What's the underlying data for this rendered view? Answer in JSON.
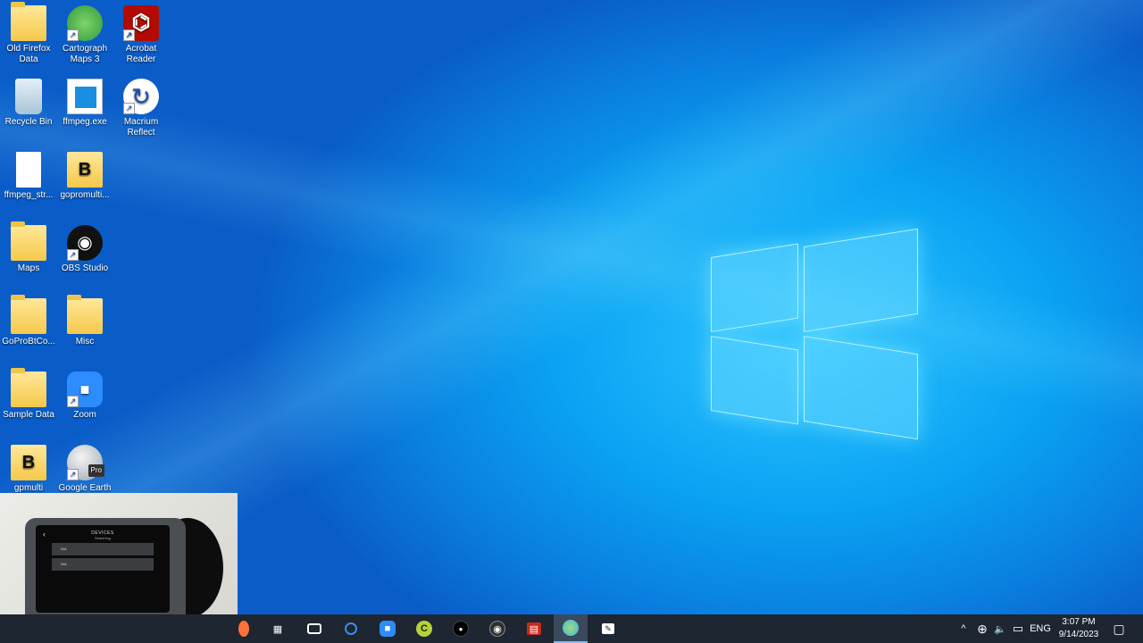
{
  "desktop": {
    "icons": [
      {
        "label": "Old Firefox Data",
        "icon": "folder-icon"
      },
      {
        "label": "Cartograph Maps 3",
        "icon": "cartograph-icon"
      },
      {
        "label": "Acrobat Reader",
        "icon": "acrobat-icon"
      },
      {
        "label": "Recycle Bin",
        "icon": "recycle-bin-icon"
      },
      {
        "label": "ffmpeg.exe",
        "icon": "ffmpeg-icon"
      },
      {
        "label": "Macrium Reflect",
        "icon": "macrium-icon"
      },
      {
        "label": "ffmpeg_str...",
        "icon": "document-icon"
      },
      {
        "label": "gopromulti...",
        "icon": "batch-file-icon"
      },
      {
        "label": "Maps",
        "icon": "folder-icon"
      },
      {
        "label": "OBS Studio",
        "icon": "obs-icon"
      },
      {
        "label": "GoProBtCo...",
        "icon": "folder-icon"
      },
      {
        "label": "Misc",
        "icon": "folder-icon"
      },
      {
        "label": "Sample Data",
        "icon": "folder-icon"
      },
      {
        "label": "Zoom",
        "icon": "zoom-icon"
      },
      {
        "label": "gpmulti",
        "icon": "batch-file-icon"
      },
      {
        "label": "Google Earth",
        "icon": "google-earth-icon"
      }
    ],
    "google_earth_badge": "Pro"
  },
  "webcam": {
    "screen_title": "DEVICES",
    "screen_subtitle": "Searching",
    "rows": [
      "N/A",
      "N/A"
    ]
  },
  "taskbar": {
    "apps": [
      {
        "name": "firefox",
        "glyph": "●",
        "color": "#ff7139"
      },
      {
        "name": "task-view",
        "glyph": "▦",
        "color": "#ffffff"
      },
      {
        "name": "camera",
        "glyph": "▭",
        "color": "#ffffff"
      },
      {
        "name": "cortana",
        "glyph": "◎",
        "color": "#3b8ced"
      },
      {
        "name": "zoom",
        "glyph": "■",
        "color": "#2d8cff"
      },
      {
        "name": "greenshot",
        "glyph": "C",
        "color": "#b6d23a"
      },
      {
        "name": "record",
        "glyph": "●",
        "color": "#000000"
      },
      {
        "name": "obs",
        "glyph": "◉",
        "color": "#303030"
      },
      {
        "name": "news",
        "glyph": "▤",
        "color": "#c42b1c"
      },
      {
        "name": "maps",
        "glyph": "◍",
        "color": "#3fb4e0"
      },
      {
        "name": "screen-tool",
        "glyph": "✎",
        "color": "#ffffff"
      }
    ],
    "tray": {
      "chevron": "^",
      "network": "⊕",
      "volume": "🔈",
      "battery": "▭",
      "language": "ENG",
      "time": "3:07 PM",
      "date": "9/14/2023",
      "notifications": "▢"
    }
  }
}
